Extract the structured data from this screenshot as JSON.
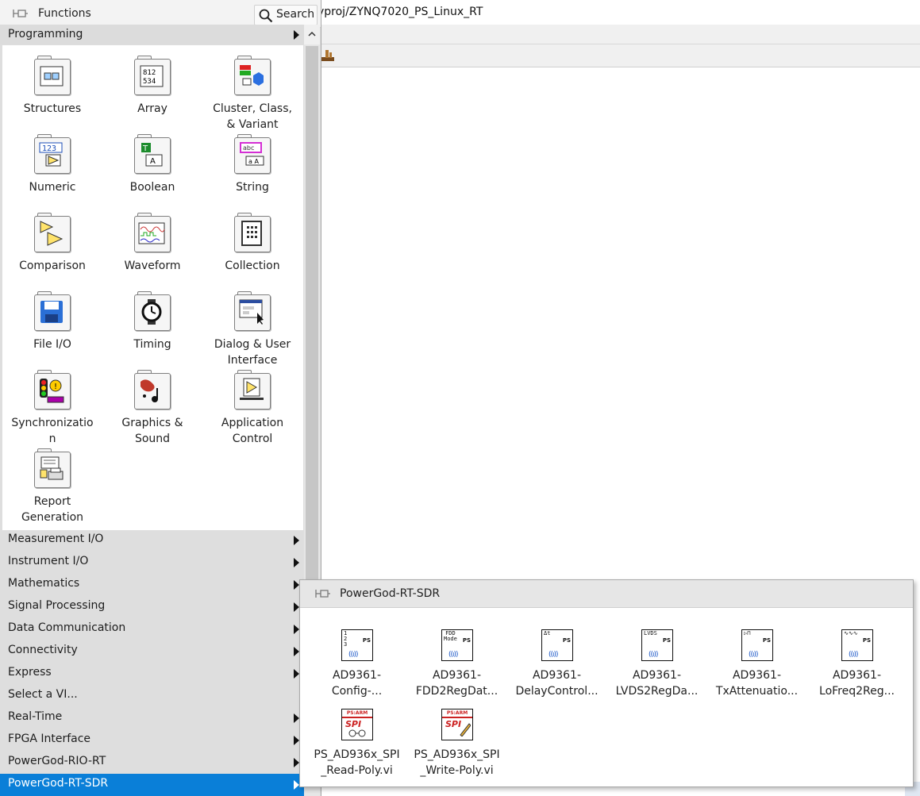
{
  "window": {
    "title": "yproj/ZYNQ7020_PS_Linux_RT"
  },
  "palette": {
    "title": "Functions",
    "search_label": "Search",
    "current_category": "Programming",
    "tiles": [
      {
        "label": "Structures",
        "icon": "structures-icon"
      },
      {
        "label": "Array",
        "icon": "array-icon"
      },
      {
        "label": "Cluster, Class, & Variant",
        "icon": "cluster-icon"
      },
      {
        "label": "Numeric",
        "icon": "numeric-icon"
      },
      {
        "label": "Boolean",
        "icon": "boolean-icon"
      },
      {
        "label": "String",
        "icon": "string-icon"
      },
      {
        "label": "Comparison",
        "icon": "comparison-icon"
      },
      {
        "label": "Waveform",
        "icon": "waveform-icon"
      },
      {
        "label": "Collection",
        "icon": "collection-icon"
      },
      {
        "label": "File I/O",
        "icon": "file-io-icon"
      },
      {
        "label": "Timing",
        "icon": "timing-icon"
      },
      {
        "label": "Dialog & User Interface",
        "icon": "dialog-icon"
      },
      {
        "label": "Synchronization",
        "icon": "synchronization-icon"
      },
      {
        "label": "Graphics & Sound",
        "icon": "graphics-sound-icon"
      },
      {
        "label": "Application Control",
        "icon": "application-control-icon"
      },
      {
        "label": "Report Generation",
        "icon": "report-generation-icon"
      }
    ],
    "tile_label_lines": [
      [
        "Structures"
      ],
      [
        "Array"
      ],
      [
        "Cluster, Class,",
        "& Variant"
      ],
      [
        "Numeric"
      ],
      [
        "Boolean"
      ],
      [
        "String"
      ],
      [
        "Comparison"
      ],
      [
        "Waveform"
      ],
      [
        "Collection"
      ],
      [
        "File I/O"
      ],
      [
        "Timing"
      ],
      [
        "Dialog & User",
        "Interface"
      ],
      [
        "Synchronizatio",
        "n"
      ],
      [
        "Graphics &",
        "Sound"
      ],
      [
        "Application",
        "Control"
      ],
      [
        "Report",
        "Generation"
      ]
    ],
    "categories": [
      {
        "label": "Measurement I/O",
        "submenu": true
      },
      {
        "label": "Instrument I/O",
        "submenu": true
      },
      {
        "label": "Mathematics",
        "submenu": true
      },
      {
        "label": "Signal Processing",
        "submenu": true
      },
      {
        "label": "Data Communication",
        "submenu": true
      },
      {
        "label": "Connectivity",
        "submenu": true
      },
      {
        "label": "Express",
        "submenu": true
      },
      {
        "label": "Select a VI...",
        "submenu": false
      },
      {
        "label": "Real-Time",
        "submenu": true
      },
      {
        "label": "FPGA Interface",
        "submenu": true
      },
      {
        "label": "PowerGod-RIO-RT",
        "submenu": true
      },
      {
        "label": "PowerGod-RT-SDR",
        "submenu": true,
        "selected": true
      }
    ]
  },
  "subpalette": {
    "title": "PowerGod-RT-SDR",
    "items": [
      {
        "lines": [
          "AD9361-",
          "Config-..."
        ],
        "icon_text": [
          "1 ",
          "2 ",
          "3 "
        ],
        "badge": "PS",
        "icon": "ad9361-config-icon"
      },
      {
        "lines": [
          "AD9361-",
          "FDD2RegDat..."
        ],
        "icon_text": [
          "FDD",
          "Mode"
        ],
        "badge": "PS",
        "icon": "ad9361-fdd-icon"
      },
      {
        "lines": [
          "AD9361-",
          "DelayControl..."
        ],
        "icon_text": [
          "Δt"
        ],
        "badge": "PS",
        "icon": "ad9361-delay-icon"
      },
      {
        "lines": [
          "AD9361-",
          "LVDS2RegDa..."
        ],
        "icon_text": [
          "LVDS"
        ],
        "badge": "PS",
        "icon": "ad9361-lvds-icon"
      },
      {
        "lines": [
          "AD9361-",
          "TxAttenuatio..."
        ],
        "icon_text": [
          "▷⊓"
        ],
        "badge": "PS",
        "icon": "ad9361-txatten-icon"
      },
      {
        "lines": [
          "AD9361-",
          "LoFreq2Reg..."
        ],
        "icon_text": [
          "∿∿∿"
        ],
        "badge": "PS",
        "icon": "ad9361-lofreq-icon"
      },
      {
        "lines": [
          "PS_AD936x_SPI",
          "_Read-Poly.vi"
        ],
        "icon_text": [
          "PS:ARM",
          "SPI"
        ],
        "badge": "",
        "icon": "spi-read-icon"
      },
      {
        "lines": [
          "PS_AD936x_SPI",
          "_Write-Poly.vi"
        ],
        "icon_text": [
          "PS:ARM",
          "SPI"
        ],
        "badge": "",
        "icon": "spi-write-icon"
      }
    ]
  },
  "colors": {
    "selected_bg": "#0a7fd8",
    "palette_bg": "#dedede",
    "antenna_blue": "#1a56c8"
  }
}
